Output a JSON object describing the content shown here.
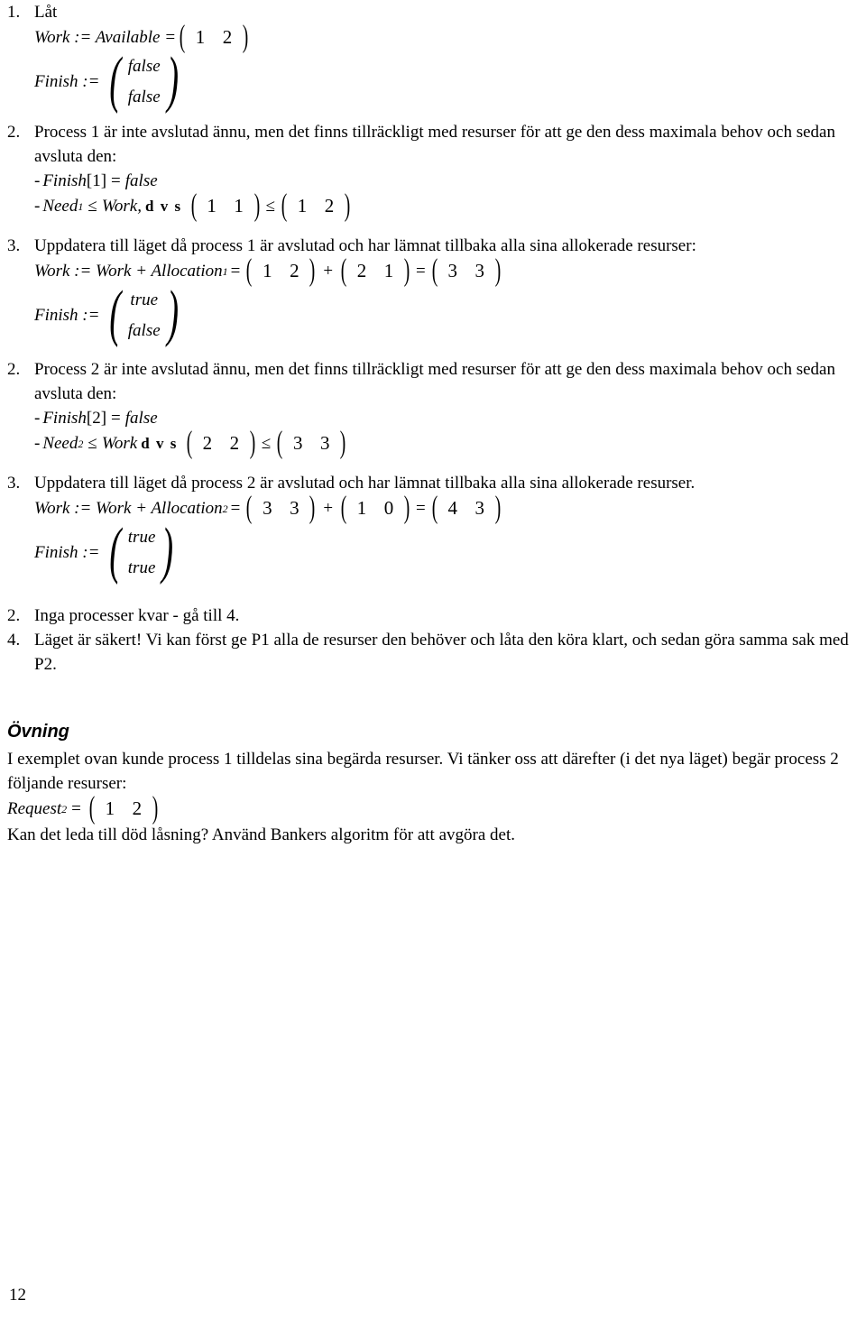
{
  "document": {
    "page_number": "12",
    "language": "sv"
  },
  "steps": [
    {
      "number": "1.",
      "heading": "Låt",
      "eq_work_label": "Work := Available =",
      "work_vector": [
        "1",
        "2"
      ],
      "finish_label": "Finish :=",
      "finish_vector": [
        "false",
        "false"
      ]
    },
    {
      "number": "2.",
      "paragraph": "Process 1 är inte avslutad ännu, men det finns tillräckligt med resurser för att ge den dess maximala behov och sedan avsluta den:",
      "bullet_finish_prefix": "-",
      "bullet_finish_name": "Finish",
      "bullet_finish_index": "[1]",
      "bullet_finish_eq": "=",
      "bullet_finish_value": "false",
      "bullet_need_prefix": "-",
      "bullet_need_name": "Need",
      "bullet_need_sub": "1",
      "bullet_need_rel": "≤",
      "bullet_need_work": "Work,",
      "bullet_need_dvs": "d v s",
      "bullet_need_left": [
        "1",
        "1"
      ],
      "bullet_need_op": "≤",
      "bullet_need_right": [
        "1",
        "2"
      ]
    },
    {
      "number": "3.",
      "paragraph": "Uppdatera till läget då process 1 är avslutad och har lämnat tillbaka alla sina allokerade resurser:",
      "work_label": "Work := Work + Allocation",
      "work_sub": "1",
      "work_eq": "=",
      "work_a": [
        "1",
        "2"
      ],
      "work_plus": "+",
      "work_b": [
        "2",
        "1"
      ],
      "work_eq2": "=",
      "work_result": [
        "3",
        "3"
      ],
      "finish_label": "Finish :=",
      "finish_vector": [
        "true",
        "false"
      ]
    },
    {
      "number": "2.",
      "paragraph": "Process 2 är inte avslutad ännu, men det finns tillräckligt med resurser för att ge den dess maximala behov och sedan avsluta den:",
      "bullet_finish_prefix": "-",
      "bullet_finish_name": "Finish",
      "bullet_finish_index": "[2]",
      "bullet_finish_eq": "=",
      "bullet_finish_value": "false",
      "bullet_need_prefix": "-",
      "bullet_need_name": "Need",
      "bullet_need_sub": "2",
      "bullet_need_rel": "≤",
      "bullet_need_work": "Work",
      "bullet_need_dvs": "d v s",
      "bullet_need_left": [
        "2",
        "2"
      ],
      "bullet_need_op": "≤",
      "bullet_need_right": [
        "3",
        "3"
      ]
    },
    {
      "number": "3.",
      "paragraph": "Uppdatera till läget då process 2 är avslutad och har lämnat tillbaka alla sina allokerade resurser.",
      "work_label": "Work := Work + Allocation",
      "work_sub": "2",
      "work_eq": "=",
      "work_a": [
        "3",
        "3"
      ],
      "work_plus": "+",
      "work_b": [
        "1",
        "0"
      ],
      "work_eq2": "=",
      "work_result": [
        "4",
        "3"
      ],
      "finish_label": "Finish :=",
      "finish_vector": [
        "true",
        "true"
      ]
    },
    {
      "number": "2.",
      "paragraph": "Inga processer kvar - gå till 4."
    },
    {
      "number": "4.",
      "paragraph": "Läget är säkert! Vi kan först ge P1 alla de resurser den behöver och låta den köra klart, och sedan göra samma sak med P2."
    }
  ],
  "ovning": {
    "heading": "Övning",
    "intro": "I exemplet ovan kunde process 1 tilldelas sina begärda resurser. Vi tänker oss att därefter (i det nya läget) begär process 2 följande resurser:",
    "request_label": "Request",
    "request_sub": "2",
    "request_eq": "=",
    "request_vector": [
      "1",
      "2"
    ],
    "question": "Kan det leda till död låsning? Använd Bankers algoritm för att avgöra det."
  }
}
